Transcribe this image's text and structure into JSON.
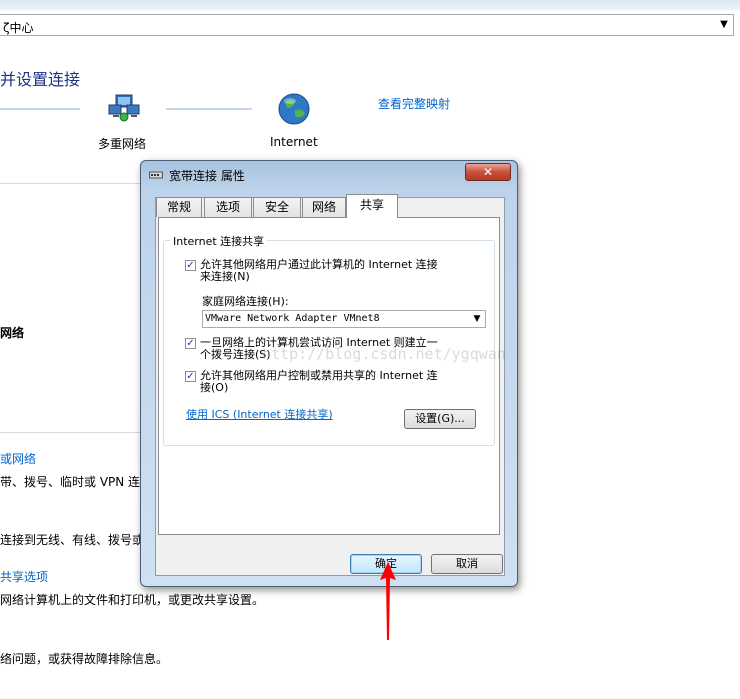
{
  "address_bar": {
    "text": "ζ中心"
  },
  "page": {
    "title": "并设置连接",
    "full_map_link": "查看完整映射",
    "network_label": "多重网络",
    "internet_label": "Internet",
    "network_name": "网络",
    "left_link_1": "或网络",
    "left_text_1": "带、拨号、临时或 VPN 连",
    "left_text_2": "连接到无线、有线、拨号或",
    "left_link_2": "共享选项",
    "left_text_3": "网络计算机上的文件和打印机，或更改共享设置。",
    "left_text_4": "络问题，或获得故障排除信息。"
  },
  "dialog": {
    "title": "宽带连接 属性",
    "close_symbol": "✕",
    "tabs": [
      {
        "label": "常规"
      },
      {
        "label": "选项"
      },
      {
        "label": "安全"
      },
      {
        "label": "网络"
      },
      {
        "label": "共享"
      }
    ],
    "active_tab": "共享",
    "group_title": "Internet 连接共享",
    "allow_share": {
      "checked": true,
      "line1": "允许其他网络用户通过此计算机的 Internet 连接",
      "line2": "来连接(N)"
    },
    "home_network_label": "家庭网络连接(H):",
    "home_network_value": "VMware Network Adapter VMnet8",
    "dial_on_demand": {
      "checked": true,
      "line1": "一旦网络上的计算机尝试访问 Internet 则建立一",
      "line2": "个拨号连接(S)"
    },
    "allow_control": {
      "checked": true,
      "line1": "允许其他网络用户控制或禁用共享的 Internet 连",
      "line2": "接(O)"
    },
    "ics_link": "使用 ICS (Internet 连接共享)",
    "settings_button": "设置(G)...",
    "ok_button": "确定",
    "cancel_button": "取消"
  },
  "watermark": "http://blog.csdn.net/ygqwan",
  "check_mark": "✓",
  "dropdown_symbol": "▼",
  "colors": {
    "link": "#0066cc",
    "annotation_arrow": "#ff0000"
  }
}
